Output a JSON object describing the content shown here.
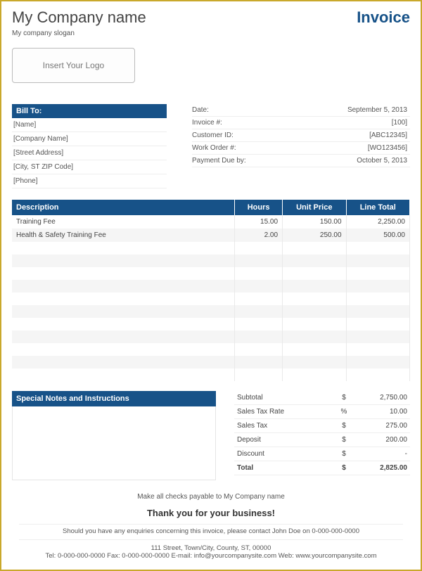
{
  "header": {
    "company_name": "My Company name",
    "slogan": "My company slogan",
    "invoice_title": "Invoice",
    "logo_placeholder": "Insert Your Logo"
  },
  "billto": {
    "header": "Bill To:",
    "name": "[Name]",
    "company": "[Company Name]",
    "street": "[Street Address]",
    "citystzip": "[City, ST  ZIP Code]",
    "phone": "[Phone]"
  },
  "meta": {
    "date_label": "Date:",
    "date_value": "September 5, 2013",
    "inv_label": "Invoice #:",
    "inv_value": "[100]",
    "cust_label": "Customer ID:",
    "cust_value": "[ABC12345]",
    "wo_label": "Work Order #:",
    "wo_value": "[WO123456]",
    "due_label": "Payment Due by:",
    "due_value": "October 5, 2013"
  },
  "items": {
    "h_desc": "Description",
    "h_hours": "Hours",
    "h_price": "Unit Price",
    "h_total": "Line Total",
    "rows": [
      {
        "desc": "Training Fee",
        "hours": "15.00",
        "price": "150.00",
        "total": "2,250.00"
      },
      {
        "desc": "Health & Safety Training Fee",
        "hours": "2.00",
        "price": "250.00",
        "total": "500.00"
      },
      {
        "desc": "",
        "hours": "",
        "price": "",
        "total": ""
      },
      {
        "desc": "",
        "hours": "",
        "price": "",
        "total": ""
      },
      {
        "desc": "",
        "hours": "",
        "price": "",
        "total": ""
      },
      {
        "desc": "",
        "hours": "",
        "price": "",
        "total": ""
      },
      {
        "desc": "",
        "hours": "",
        "price": "",
        "total": ""
      },
      {
        "desc": "",
        "hours": "",
        "price": "",
        "total": ""
      },
      {
        "desc": "",
        "hours": "",
        "price": "",
        "total": ""
      },
      {
        "desc": "",
        "hours": "",
        "price": "",
        "total": ""
      },
      {
        "desc": "",
        "hours": "",
        "price": "",
        "total": ""
      },
      {
        "desc": "",
        "hours": "",
        "price": "",
        "total": ""
      },
      {
        "desc": "",
        "hours": "",
        "price": "",
        "total": ""
      }
    ]
  },
  "notes": {
    "header": "Special Notes and Instructions"
  },
  "totals": {
    "subtotal_l": "Subtotal",
    "subtotal_s": "$",
    "subtotal_v": "2,750.00",
    "taxrate_l": "Sales Tax Rate",
    "taxrate_s": "%",
    "taxrate_v": "10.00",
    "tax_l": "Sales Tax",
    "tax_s": "$",
    "tax_v": "275.00",
    "deposit_l": "Deposit",
    "deposit_s": "$",
    "deposit_v": "200.00",
    "discount_l": "Discount",
    "discount_s": "$",
    "discount_v": "-",
    "total_l": "Total",
    "total_s": "$",
    "total_v": "2,825.00"
  },
  "footer": {
    "payable": "Make all checks payable to My Company name",
    "thankyou": "Thank you for your business!",
    "enquiries": "Should you have any enquiries concerning this invoice, please contact John Doe on 0-000-000-0000",
    "addr": "111 Street, Town/City, County, ST, 00000",
    "web": "Tel: 0-000-000-0000 Fax: 0-000-000-0000 E-mail: info@yourcompanysite.com Web: www.yourcompanysite.com"
  }
}
